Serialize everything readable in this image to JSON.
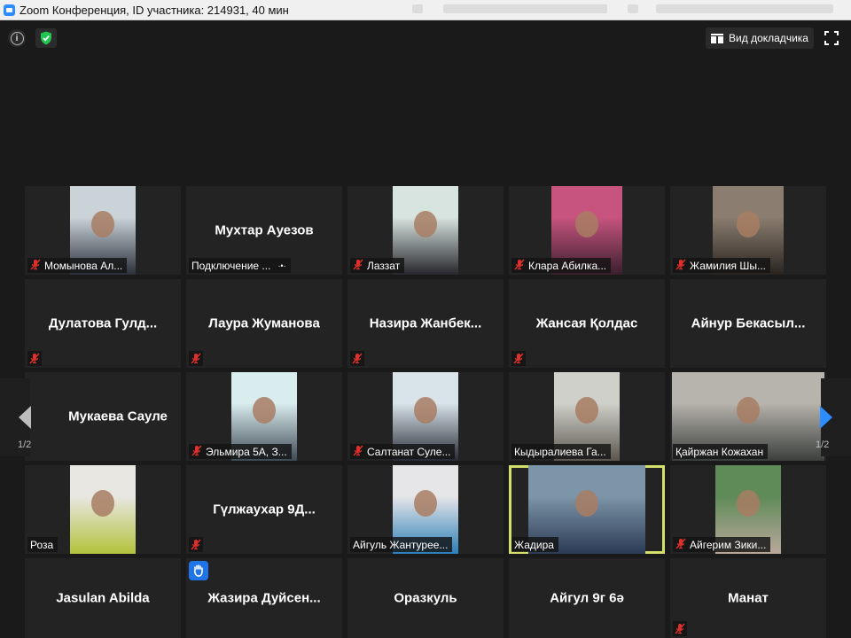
{
  "window": {
    "title": "Zoom Конференция, ID участника: 214931, 40 мин"
  },
  "topbar": {
    "info_icon": "info-icon",
    "security_icon": "shield-check-icon",
    "speaker_view_label": "Вид докладчика",
    "fullscreen_icon": "fullscreen-icon"
  },
  "colors": {
    "background": "#1a1a1a",
    "tile": "#232323",
    "active_speaker_border": "#d4e06b",
    "muted_icon": "#e0302c",
    "raise_hand": "#1e74e8",
    "nav_arrow": "#2d8cff"
  },
  "pagination": {
    "left_label": "1/2",
    "right_label": "1/2"
  },
  "participants": [
    {
      "name": "Момынова Ал...",
      "video": true,
      "muted": true
    },
    {
      "name": "Мухтар Ауезов",
      "video": false,
      "status": "Подключение ...",
      "muted": false
    },
    {
      "name": "Лаззат",
      "video": true,
      "muted": true
    },
    {
      "name": "Клара Абилка...",
      "video": true,
      "muted": true
    },
    {
      "name": "Жамилия Шы...",
      "video": true,
      "muted": true
    },
    {
      "name": "Дулатова Гулд...",
      "video": false,
      "muted": true
    },
    {
      "name": "Лаура Жуманова",
      "video": false,
      "muted": true
    },
    {
      "name": "Назира Жанбек...",
      "video": false,
      "muted": true
    },
    {
      "name": "Жансая Қолдас",
      "video": false,
      "muted": true
    },
    {
      "name": "Айнур Бекасыл...",
      "video": false,
      "muted": false
    },
    {
      "name": "Мукаева Сауле",
      "video": false,
      "muted": false
    },
    {
      "name": "Эльмира 5А, З...",
      "video": true,
      "muted": true
    },
    {
      "name": "Салтанат Суле...",
      "video": true,
      "muted": true
    },
    {
      "name": "Кыдыралиева Га...",
      "video": true,
      "muted": false
    },
    {
      "name": "Қайржан Кожахан",
      "video": true,
      "muted": false
    },
    {
      "name": "Роза",
      "video": true,
      "muted": false
    },
    {
      "name": "Гүлжаухар 9Д...",
      "video": false,
      "muted": true
    },
    {
      "name": "Айгуль Жантурее...",
      "video": true,
      "muted": false
    },
    {
      "name": "Жадира",
      "video": true,
      "muted": false,
      "active_speaker": true
    },
    {
      "name": "Айгерим Зики...",
      "video": true,
      "muted": true
    },
    {
      "name": "Jasulan Abilda",
      "video": false,
      "muted": false
    },
    {
      "name": "Жазира Дуйсен...",
      "video": false,
      "muted": false,
      "hand_raised": true
    },
    {
      "name": "Оразкуль",
      "video": false,
      "muted": false
    },
    {
      "name": "Айгул 9г 6ә",
      "video": false,
      "muted": false
    },
    {
      "name": "Манат",
      "video": false,
      "muted": true
    }
  ]
}
